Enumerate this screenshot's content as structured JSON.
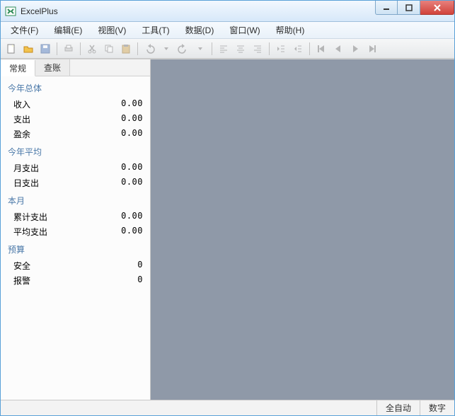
{
  "window": {
    "title": "ExcelPlus"
  },
  "menu": {
    "file": "文件(F)",
    "edit": "编辑(E)",
    "view": "视图(V)",
    "tools": "工具(T)",
    "data": "数据(D)",
    "window": "窗口(W)",
    "help": "帮助(H)"
  },
  "tabs": {
    "general": "常规",
    "ledger": "查账"
  },
  "groups": [
    {
      "header": "今年总体",
      "rows": [
        {
          "label": "收入",
          "value": "0.00"
        },
        {
          "label": "支出",
          "value": "0.00"
        },
        {
          "label": "盈余",
          "value": "0.00"
        }
      ]
    },
    {
      "header": "今年平均",
      "rows": [
        {
          "label": "月支出",
          "value": "0.00"
        },
        {
          "label": "日支出",
          "value": "0.00"
        }
      ]
    },
    {
      "header": "本月",
      "rows": [
        {
          "label": "累计支出",
          "value": "0.00"
        },
        {
          "label": "平均支出",
          "value": "0.00"
        }
      ]
    },
    {
      "header": "预算",
      "rows": [
        {
          "label": "安全",
          "value": "0"
        },
        {
          "label": "报警",
          "value": "0"
        }
      ]
    }
  ],
  "status": {
    "mode": "全自动",
    "indicator": "数字"
  }
}
